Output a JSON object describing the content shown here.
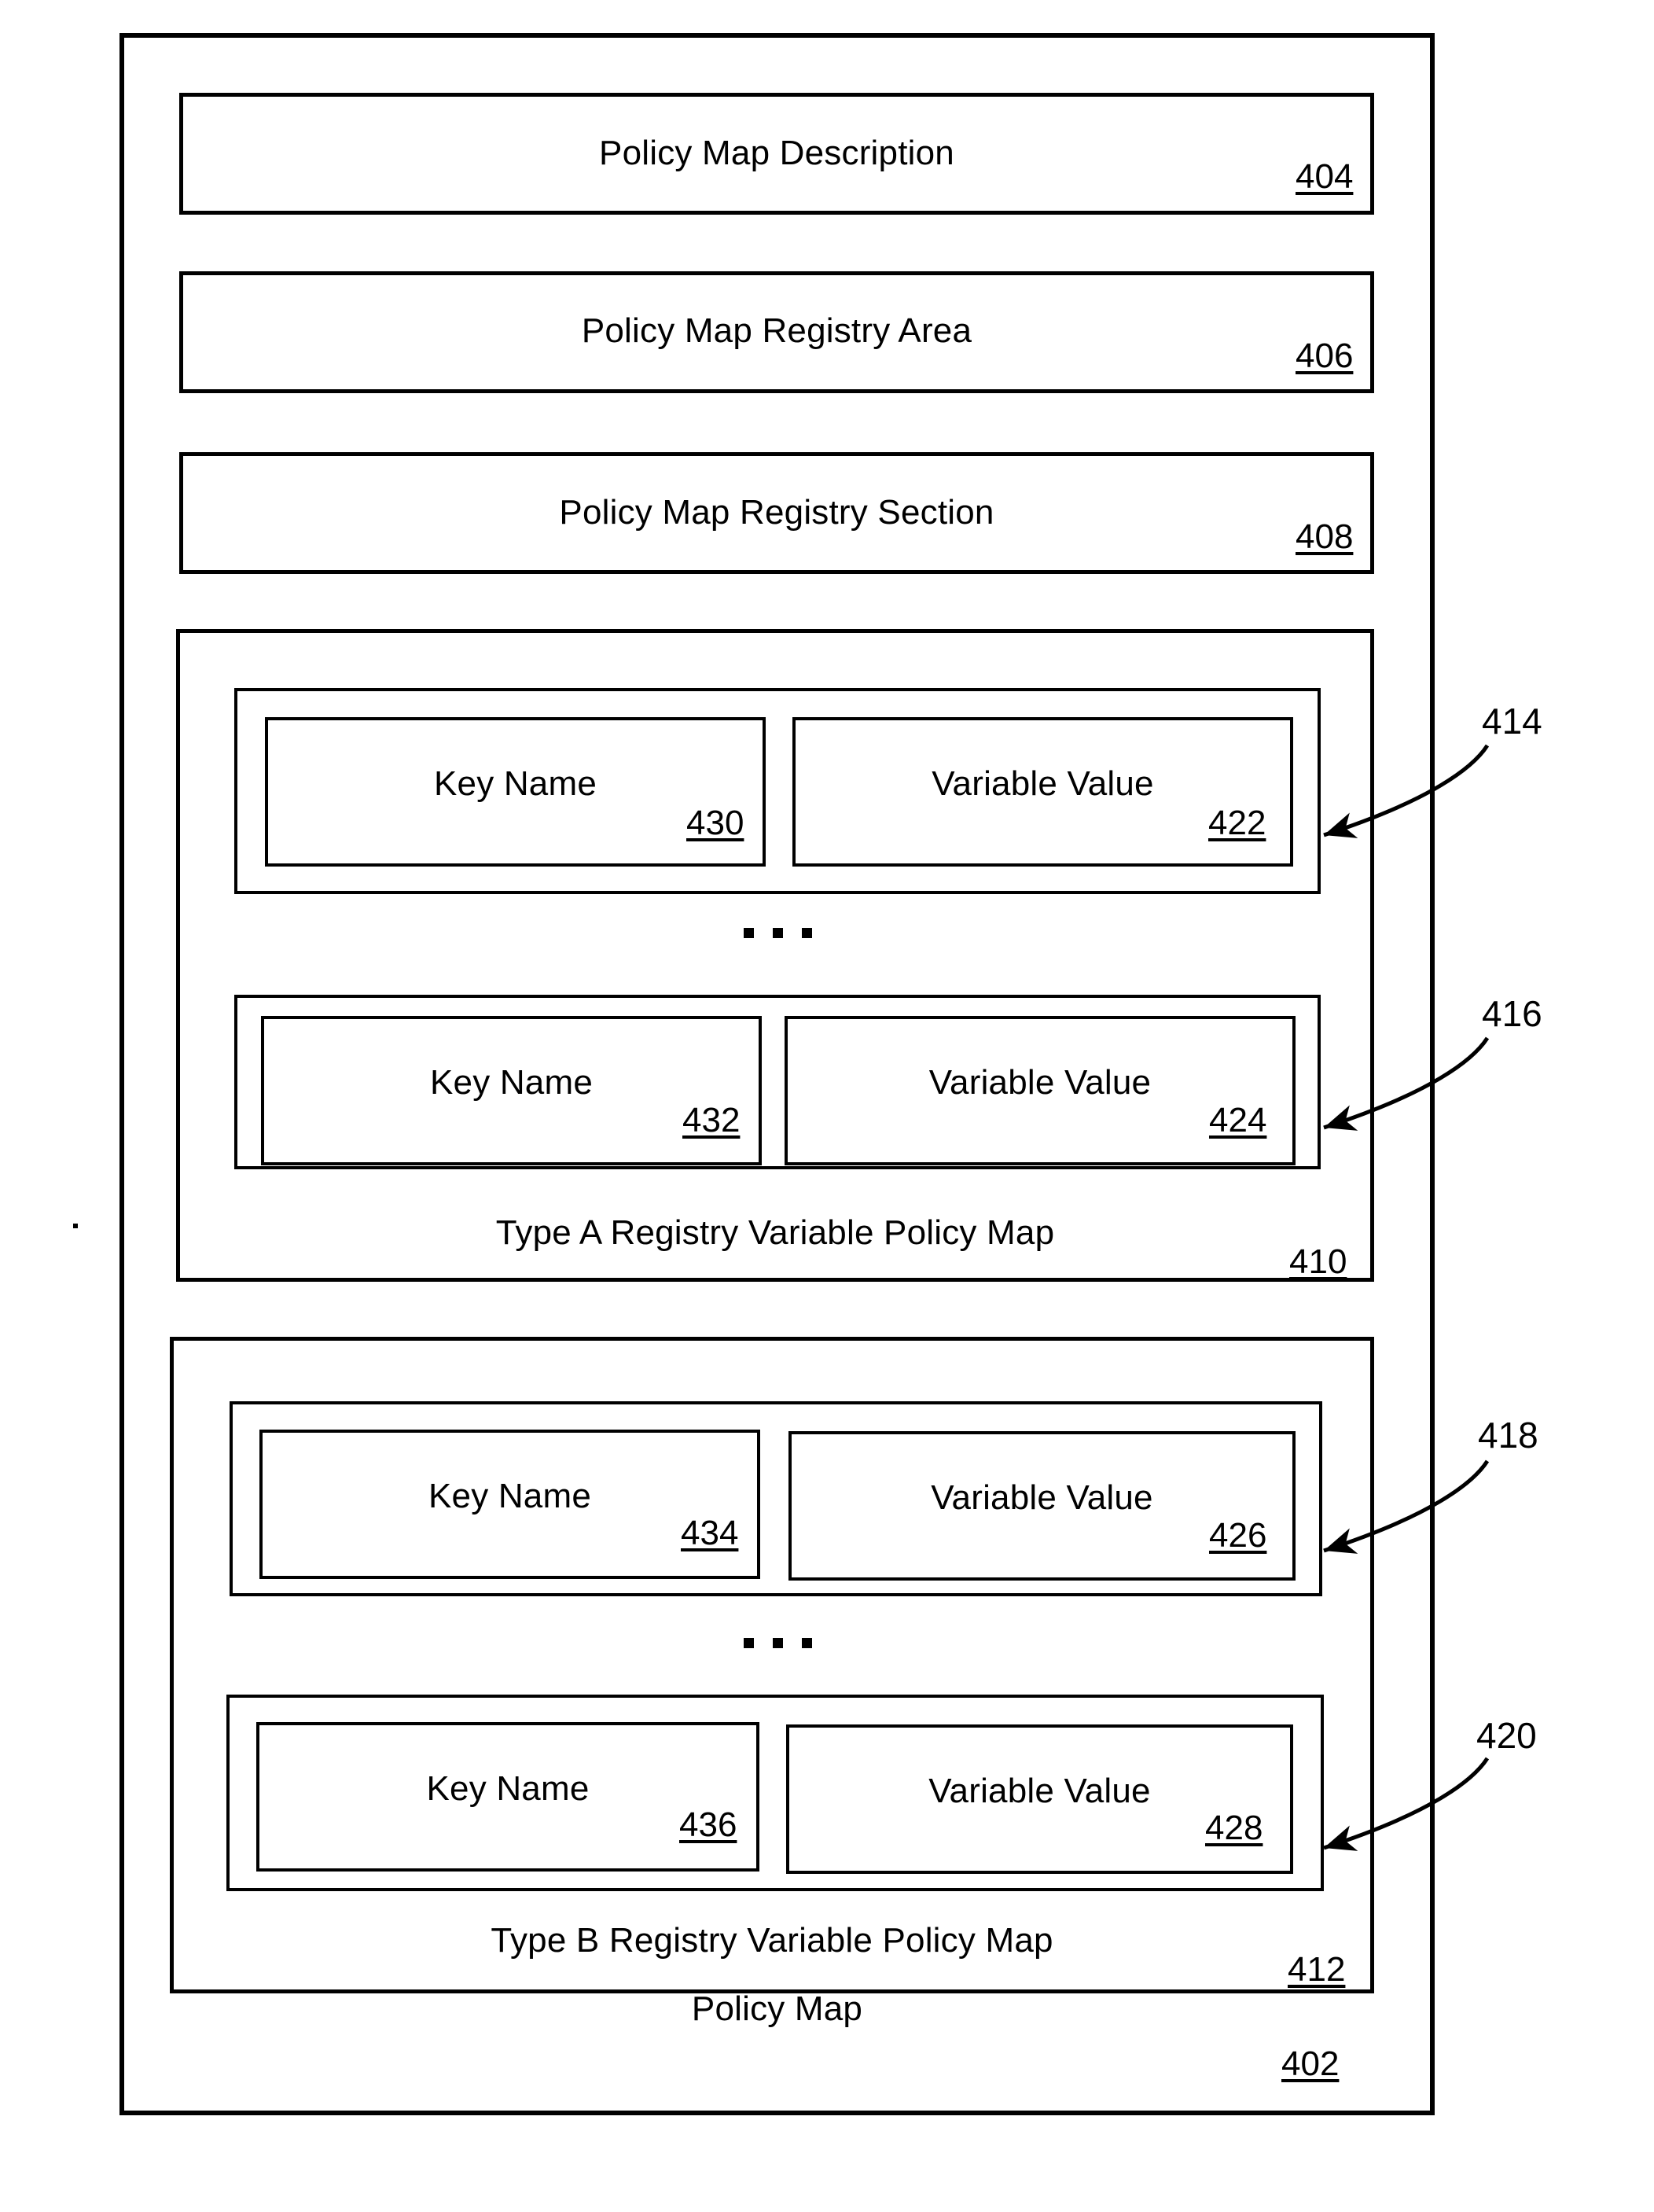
{
  "figure": {
    "outer": {
      "title": "Policy Map",
      "ref": "402"
    },
    "top_sections": [
      {
        "title": "Policy Map Description",
        "ref": "404"
      },
      {
        "title": "Policy Map Registry Area",
        "ref": "406"
      },
      {
        "title": "Policy Map Registry Section",
        "ref": "408"
      }
    ],
    "registry_maps": [
      {
        "title": "Type A Registry Variable Policy Map",
        "ref": "410",
        "ellipsis": "...",
        "rows": [
          {
            "callout": "414",
            "key": {
              "label": "Key Name",
              "ref": "430"
            },
            "value": {
              "label": "Variable Value",
              "ref": "422"
            }
          },
          {
            "callout": "416",
            "key": {
              "label": "Key Name",
              "ref": "432"
            },
            "value": {
              "label": "Variable Value",
              "ref": "424"
            }
          }
        ]
      },
      {
        "title": "Type B Registry Variable Policy Map",
        "ref": "412",
        "ellipsis": "...",
        "rows": [
          {
            "callout": "418",
            "key": {
              "label": "Key Name",
              "ref": "434"
            },
            "value": {
              "label": "Variable Value",
              "ref": "426"
            }
          },
          {
            "callout": "420",
            "key": {
              "label": "Key Name",
              "ref": "436"
            },
            "value": {
              "label": "Variable Value",
              "ref": "428"
            }
          }
        ]
      }
    ],
    "colors": {
      "ink": "#000000",
      "paper": "#ffffff"
    }
  }
}
